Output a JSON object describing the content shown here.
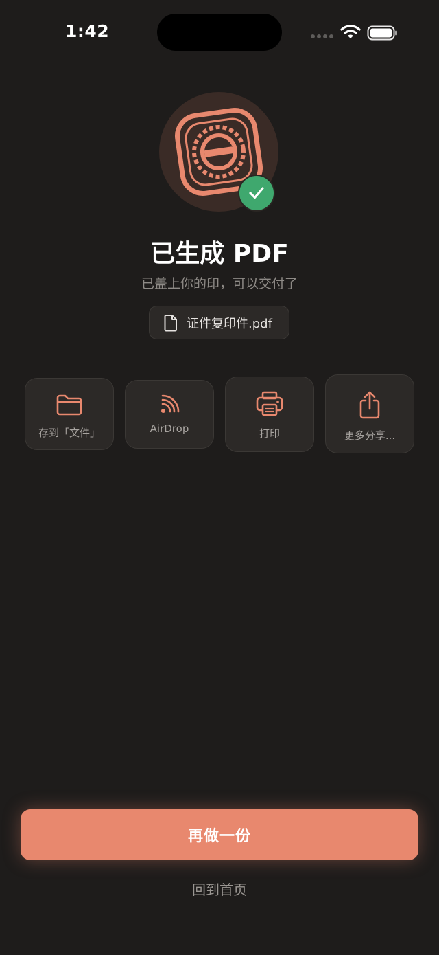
{
  "status_bar": {
    "time": "1:42"
  },
  "header": {
    "title": "已生成 PDF",
    "subtitle": "已盖上你的印，可以交付了"
  },
  "file": {
    "name": "证件复印件.pdf",
    "icon": "document-icon"
  },
  "actions": [
    {
      "label": "存到「文件」",
      "icon": "folder-icon"
    },
    {
      "label": "AirDrop",
      "icon": "airdrop-icon"
    },
    {
      "label": "打印",
      "icon": "printer-icon"
    },
    {
      "label": "更多分享...",
      "icon": "share-icon"
    }
  ],
  "primary_button": {
    "label": "再做一份"
  },
  "home_link": {
    "label": "回到首页"
  },
  "colors": {
    "background": "#1e1c1b",
    "accent": "#e8886e",
    "success": "#3fa86e",
    "card": "#2c2927"
  }
}
